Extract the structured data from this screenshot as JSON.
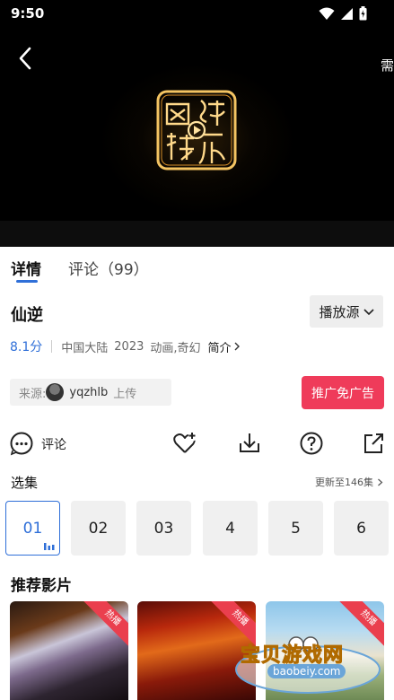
{
  "status": {
    "time": "9:50"
  },
  "player": {
    "side_label": "需"
  },
  "tabs": {
    "details": "详情",
    "comments": "评论（99）"
  },
  "video": {
    "title": "仙逆",
    "source_label": "播放源",
    "score": "8.1分",
    "region": "中国大陆",
    "year": "2023",
    "genres": "动画,奇幻",
    "intro_label": "简介"
  },
  "uploader": {
    "prefix": "来源:",
    "name": "yqzhlb",
    "suffix": "上传"
  },
  "ad_button": "推广免广告",
  "actions": {
    "comment_label": "评论"
  },
  "episodes": {
    "title": "选集",
    "update_text": "更新至146集",
    "items": [
      "01",
      "02",
      "03",
      "4",
      "5",
      "6"
    ]
  },
  "recommend": {
    "title": "推荐影片",
    "badges": [
      "热播",
      "热播",
      "热播"
    ]
  },
  "watermark": {
    "text": "宝贝游戏网",
    "url": "baobeiy.com"
  },
  "colors": {
    "accent": "#2f6fd8",
    "ad": "#ef3b5a",
    "hot": "#ea3f4e"
  }
}
